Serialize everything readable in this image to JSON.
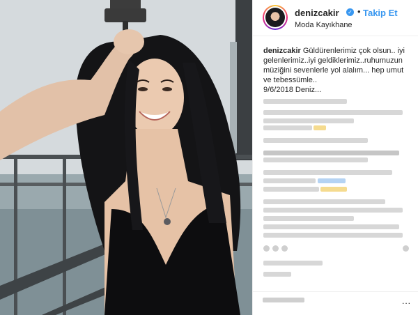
{
  "header": {
    "username": "denizcakir",
    "verified_icon": "verified-badge-icon",
    "separator": "•",
    "follow_label": "Takip Et",
    "location": "Moda Kayıkhane"
  },
  "caption": {
    "username": "denizcakir",
    "text": "Güldürenlerimiz çok olsun.. iyi gelenlerimiz..iyi geldiklerimiz..ruhumuzun müziğini sevenlerle yol alalım... hep umut ve tebessümle..",
    "date_line": "9/6/2018 Deniz..."
  },
  "footer": {
    "more_icon": "more-options-icon",
    "more_label": "..."
  },
  "colors": {
    "accent": "#3897f0",
    "text": "#262626",
    "divider": "#efefef"
  }
}
